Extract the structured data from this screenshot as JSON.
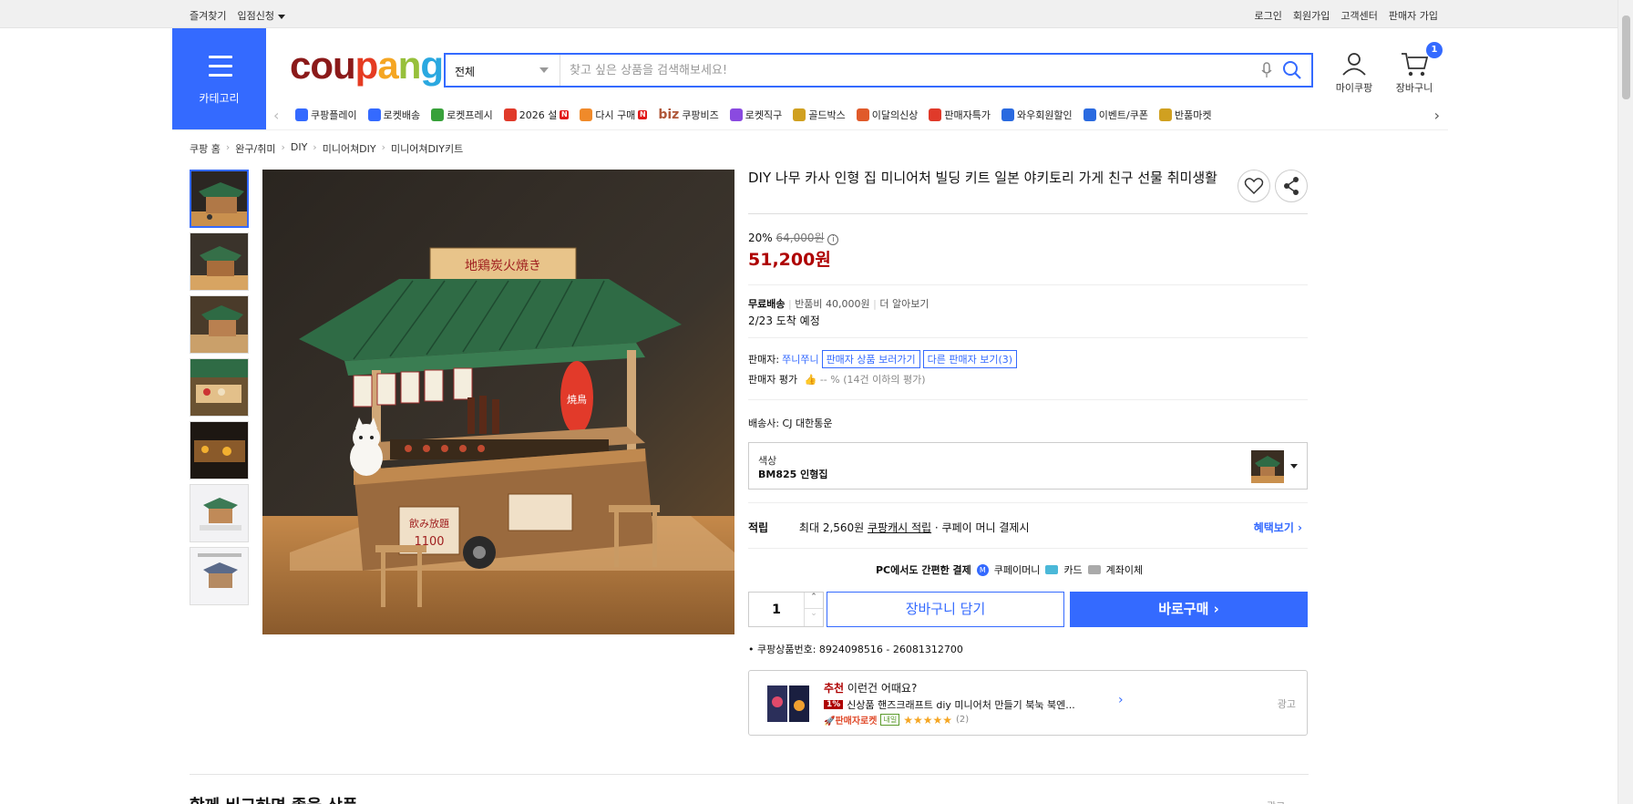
{
  "topbar": {
    "left": [
      "즐겨찾기",
      "입점신청"
    ],
    "right": [
      "로그인",
      "회원가입",
      "고객센터",
      "판매자 가입"
    ]
  },
  "header": {
    "category_label": "카테고리",
    "logo_text": [
      "cou",
      "p",
      "a",
      "n",
      "g"
    ],
    "search": {
      "scope": "전체",
      "placeholder": "찾고 싶은 상품을 검색해보세요!"
    },
    "mycoupang_label": "마이쿠팡",
    "cart_label": "장바구니",
    "cart_count": "1"
  },
  "category_nav": [
    {
      "label": "쿠팡플레이",
      "icon": "play-icon",
      "badge": ""
    },
    {
      "label": "로켓배송",
      "icon": "rocket-icon",
      "badge": ""
    },
    {
      "label": "로켓프레시",
      "icon": "rocket-fresh-icon",
      "badge": ""
    },
    {
      "label": "2026 설",
      "icon": "gift-icon",
      "badge": "N"
    },
    {
      "label": "다시 구매",
      "icon": "repurchase-icon",
      "badge": "N"
    },
    {
      "label": "쿠팡비즈",
      "icon": "biz-icon",
      "badge": "",
      "prefix": "biz"
    },
    {
      "label": "로켓직구",
      "icon": "global-icon",
      "badge": ""
    },
    {
      "label": "골드박스",
      "icon": "goldbox-icon",
      "badge": ""
    },
    {
      "label": "이달의신상",
      "icon": "new-icon",
      "badge": ""
    },
    {
      "label": "판매자특가",
      "icon": "percent-icon",
      "badge": ""
    },
    {
      "label": "와우회원할인",
      "icon": "wow-icon",
      "badge": ""
    },
    {
      "label": "이벤트/쿠폰",
      "icon": "coupon-icon",
      "badge": ""
    },
    {
      "label": "반품마켓",
      "icon": "market-icon",
      "badge": ""
    }
  ],
  "breadcrumb": [
    "쿠팡 홈",
    "완구/취미",
    "DIY",
    "미니어쳐DIY",
    "미니어쳐DIY키트"
  ],
  "product": {
    "title": "DIY 나무 카사 인형 집 미니어처 빌딩 키트 일본 야키토리 가게 친구 선물 취미생활",
    "discount": "20%",
    "original_price": "64,000원",
    "sale_price": "51,200원",
    "shipping_free": "무료배송",
    "return_fee": "반품비 40,000원",
    "more": "더 알아보기",
    "arrival": "2/23 도착 예정",
    "seller_label": "판매자:",
    "seller_name": "쭈니쭈니",
    "seller_products": "판매자 상품 보러가기",
    "other_sellers": "다른 판매자 보기",
    "other_sellers_count": "(3)",
    "seller_rating_label": "판매자 평가",
    "seller_rating_value": "-- % (14건 이하의 평가)",
    "carrier": "배송사:  CJ 대한통운",
    "option_label": "색상",
    "option_value": "BM825 인형집",
    "reward_label": "적립",
    "reward_text_a": "최대 2,560원 ",
    "reward_link": "쿠팡캐시 적립",
    "reward_text_b": " · 쿠페이 머니 결제시",
    "benefit_link": "혜택보기",
    "pay_text": "PC에서도 간편한 결제",
    "pay_money": "쿠페이머니",
    "pay_card": "카드",
    "pay_bank": "계좌이체",
    "quantity": "1",
    "add_to_cart": "장바구니 담기",
    "buy_now": "바로구매",
    "product_number": "쿠팡상품번호: 8924098516 - 26081312700"
  },
  "recommend": {
    "tag": "추천",
    "heading": "이런건 어때요?",
    "badge": "1%",
    "name": "신상품 핸즈크래프트 diy 미니어처 만들기 북눅 북엔...",
    "seller_rocket": "판매자로켓",
    "rocket_tag": "내일",
    "stars": "★★★★★",
    "review_count": "(2)",
    "ad": "광고"
  },
  "next_section_title": "함께 비교하면 좋을 상품",
  "next_section_ad": "광고"
}
